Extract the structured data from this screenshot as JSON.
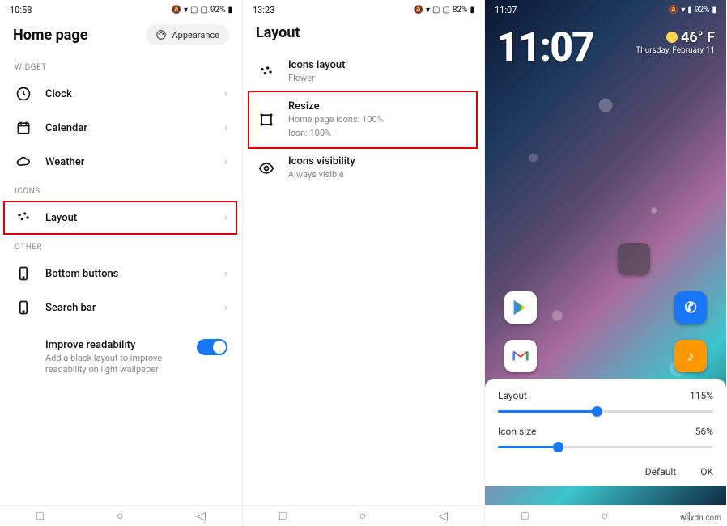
{
  "pane1": {
    "time": "10:58",
    "battery": "92%",
    "title": "Home page",
    "appearance_label": "Appearance",
    "sections": {
      "widget": "WIDGET",
      "icons": "ICONS",
      "other": "OTHER"
    },
    "rows": {
      "clock": "Clock",
      "calendar": "Calendar",
      "weather": "Weather",
      "layout": "Layout",
      "bottom_buttons": "Bottom buttons",
      "search_bar": "Search bar",
      "improve_title": "Improve readability",
      "improve_sub": "Add a black layout to improve readability on light wallpaper"
    }
  },
  "pane2": {
    "time": "13:23",
    "battery": "82%",
    "title": "Layout",
    "rows": {
      "icons_layout_title": "Icons layout",
      "icons_layout_sub": "Flower",
      "resize_title": "Resize",
      "resize_sub1": "Home page icons: 100%",
      "resize_sub2": "Icon: 100%",
      "visibility_title": "Icons visibility",
      "visibility_sub": "Always visible"
    }
  },
  "pane3": {
    "time": "11:07",
    "battery": "92%",
    "clock": "11:07",
    "weather_temp": "46° F",
    "weather_date": "Thursday, February 11",
    "sheet": {
      "layout_label": "Layout",
      "layout_value": "115%",
      "icon_label": "Icon size",
      "icon_value": "56%",
      "default": "Default",
      "ok": "OK"
    }
  },
  "watermark": "wsxdn.com"
}
